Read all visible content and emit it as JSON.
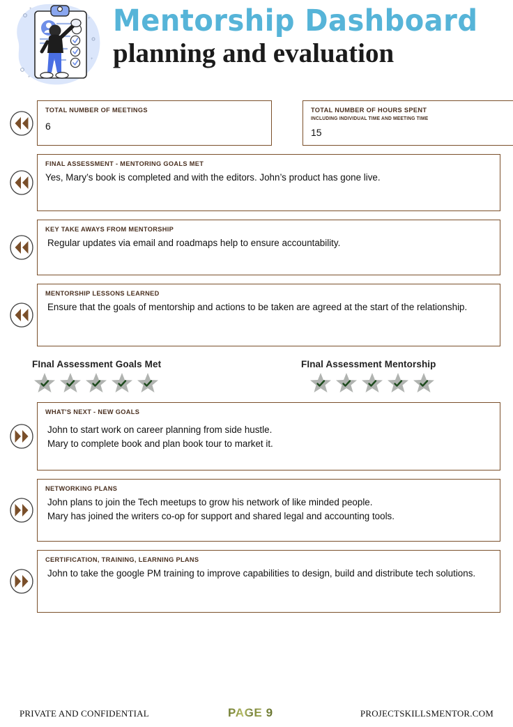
{
  "header": {
    "title_main": "Mentorship  Dashboard",
    "title_sub": "planning and evaluation",
    "illustration_name": "clipboard-checklist-person-illustration",
    "accent_color": "#56b4d8",
    "border_color": "#7a4f2a"
  },
  "stats": [
    {
      "label": "TOTAL NUMBER OF MEETINGS",
      "sublabel": "",
      "value": "6",
      "icon": "rewind-double-left-icon"
    },
    {
      "label": "TOTAL NUMBER OF HOURS SPENT",
      "sublabel": "INCLUDING INDIVIDUAL TIME AND MEETING TIME",
      "value": "15",
      "icon": ""
    }
  ],
  "review_sections": [
    {
      "label": "FINAL ASSESSMENT -  MENTORING GOALS MET",
      "body": "Yes, Mary’s book is completed and with the editors.  John’s product has gone live.",
      "icon": "rewind-double-left-icon"
    },
    {
      "label": "KEY TAKE AWAYS FROM MENTORSHIP",
      "body": "Regular updates via email and roadmaps help to ensure accountability.",
      "icon": "rewind-double-left-icon"
    },
    {
      "label": "MENTORSHIP LESSONS LEARNED",
      "body": "Ensure that the goals of mentorship and actions to be taken are agreed at the start of the relationship.",
      "icon": "rewind-double-left-icon"
    }
  ],
  "ratings": [
    {
      "title": "FInal Assessment Goals Met",
      "stars_total": 5,
      "stars_checked": 5,
      "star_color": "#b0b3b0",
      "check_color": "#1d4a1d"
    },
    {
      "title": "FInal Assessment Mentorship",
      "stars_total": 5,
      "stars_checked": 5,
      "star_color": "#b0b3b0",
      "check_color": "#1d4a1d"
    }
  ],
  "forward_sections": [
    {
      "label": "WHAT'S NEXT - NEW GOALS",
      "body": "John to start work on career planning from side hustle.\nMary to complete book and plan book tour to market it.",
      "icon": "fast-forward-double-right-icon"
    },
    {
      "label": "NETWORKING PLANS",
      "body": "John plans to join the Tech meetups to grow his network of like minded people.\nMary has joined the writers co-op for support and shared legal and accounting tools.",
      "icon": "fast-forward-double-right-icon"
    },
    {
      "label": "CERTIFICATION, TRAINING, LEARNING PLANS",
      "body": "John to take the google PM training to improve capabilities to design, build and distribute tech solutions.",
      "icon": "fast-forward-double-right-icon"
    }
  ],
  "footer": {
    "left": "PRIVATE AND CONFIDENTIAL",
    "center": "PAGE 9",
    "right": "PROJECTSKILLSMENTOR.COM"
  }
}
